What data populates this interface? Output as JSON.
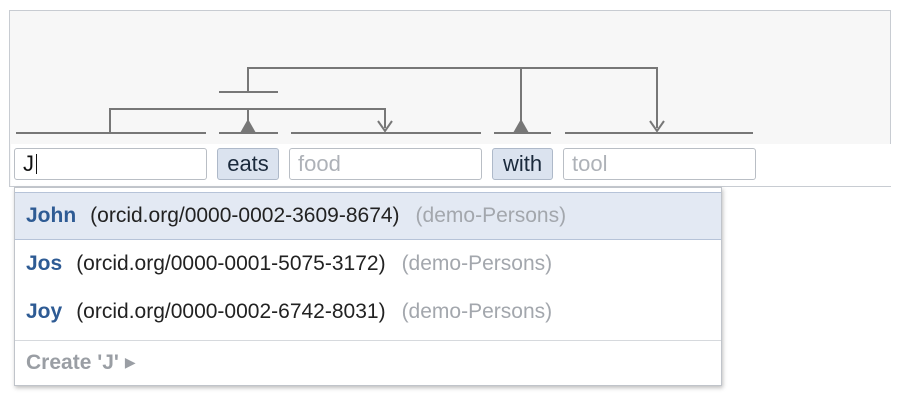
{
  "editor": {
    "subject_input": {
      "value": "J"
    },
    "relation_1": {
      "label": "eats"
    },
    "object_1": {
      "placeholder": "food"
    },
    "relation_2": {
      "label": "with"
    },
    "object_2": {
      "placeholder": "tool"
    }
  },
  "autocomplete": {
    "items": [
      {
        "name": "John",
        "id": "(orcid.org/0000-0002-3609-8674)",
        "source": "(demo-Persons)",
        "selected": true
      },
      {
        "name": "Jos",
        "id": "(orcid.org/0000-0001-5075-3172)",
        "source": "(demo-Persons)",
        "selected": false
      },
      {
        "name": "Joy",
        "id": "(orcid.org/0000-0002-6742-8031)",
        "source": "(demo-Persons)",
        "selected": false
      }
    ],
    "create_label": "Create 'J'",
    "create_arrow_icon": "triangle-right-icon"
  },
  "colors": {
    "link_line": "#777777",
    "chip_bg": "#dbe3ef",
    "selected_row": "#e3e9f3",
    "item_name": "#2e5b94"
  }
}
